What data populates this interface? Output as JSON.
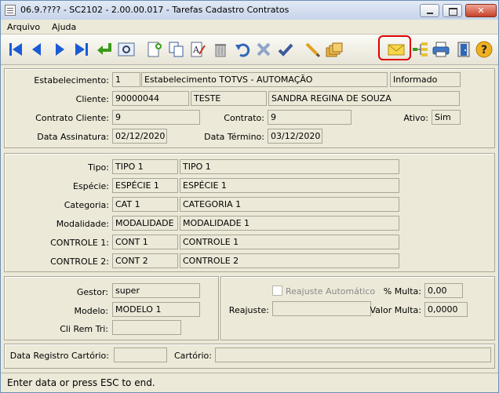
{
  "window": {
    "title": "06.9.???? - SC2102 - 2.00.00.017 - Tarefas Cadastro Contratos"
  },
  "menu": {
    "arquivo": "Arquivo",
    "ajuda": "Ajuda"
  },
  "toolbar": {
    "icons": [
      "first-icon",
      "previous-icon",
      "next-icon",
      "last-icon",
      "goto-icon",
      "search-icon",
      "new-icon",
      "copy-icon",
      "edit-icon",
      "delete-icon",
      "undo-icon",
      "cancel-icon",
      "save-icon",
      "pencil-icon",
      "folders-icon",
      "mail-icon",
      "tree-icon",
      "print-icon",
      "exit-icon",
      "help-icon"
    ],
    "colors": {
      "highlight": "#e00000",
      "nav_blue": "#1a5bd6"
    }
  },
  "header": {
    "estabelecimento_label": "Estabelecimento:",
    "estabelecimento_code": "1",
    "estabelecimento_name": "Estabelecimento TOTVS - AUTOMAÇÃO",
    "estabelecimento_status": "Informado",
    "cliente_label": "Cliente:",
    "cliente_code": "90000044",
    "cliente_short": "TESTE",
    "cliente_name": "SANDRA REGINA DE SOUZA",
    "contrato_cliente_label": "Contrato Cliente:",
    "contrato_cliente_value": "9",
    "contrato_label": "Contrato:",
    "contrato_value": "9",
    "ativo_label": "Ativo:",
    "ativo_value": "Sim",
    "data_assinatura_label": "Data Assinatura:",
    "data_assinatura_value": "02/12/2020",
    "data_termino_label": "Data Término:",
    "data_termino_value": "03/12/2020"
  },
  "classification": {
    "rows": [
      {
        "label": "Tipo:",
        "code": "TIPO 1",
        "desc": "TIPO 1"
      },
      {
        "label": "Espécie:",
        "code": "ESPÉCIE 1",
        "desc": "ESPÉCIE 1"
      },
      {
        "label": "Categoria:",
        "code": "CAT 1",
        "desc": "CATEGORIA 1"
      },
      {
        "label": "Modalidade:",
        "code": "MODALIDADE 1",
        "desc": "MODALIDADE 1"
      },
      {
        "label": "CONTROLE 1:",
        "code": "CONT 1",
        "desc": "CONTROLE 1"
      },
      {
        "label": "CONTROLE 2:",
        "code": "CONT 2",
        "desc": "CONTROLE 2"
      }
    ]
  },
  "details": {
    "gestor_label": "Gestor:",
    "gestor_value": "super",
    "modelo_label": "Modelo:",
    "modelo_value": "MODELO 1",
    "cli_rem_tri_label": "Cli Rem Tri:",
    "cli_rem_tri_value": "",
    "reajuste_automatico_label": "Reajuste Automático",
    "reajuste_label": "Reajuste:",
    "reajuste_value": "",
    "multa_pct_label": "% Multa:",
    "multa_pct_value": "0,00",
    "valor_multa_label": "Valor Multa:",
    "valor_multa_value": "0,0000"
  },
  "registry": {
    "data_registro_label": "Data Registro Cartório:",
    "data_registro_value": "",
    "cartorio_label": "Cartório:",
    "cartorio_value": ""
  },
  "status": {
    "text": "Enter data or press ESC to end."
  }
}
